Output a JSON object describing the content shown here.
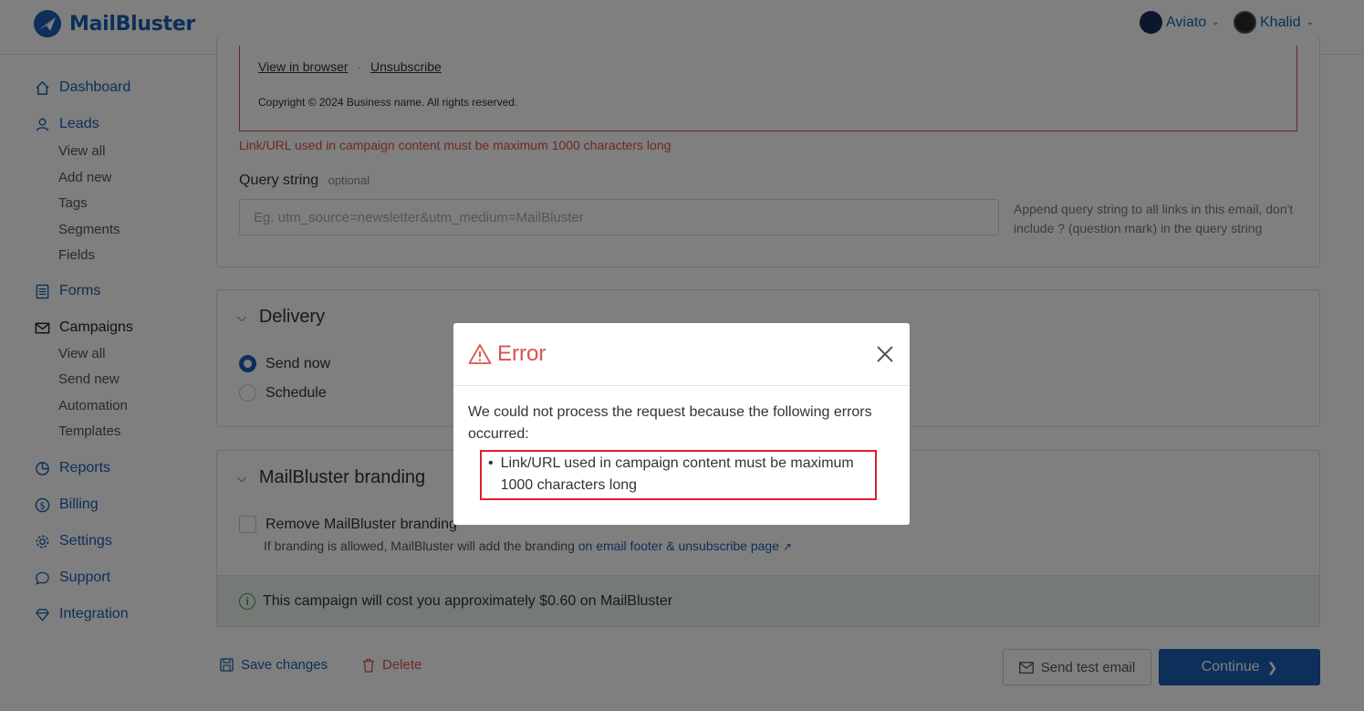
{
  "header": {
    "brand": "MailBluster",
    "org_menu": "Aviato",
    "user_menu": "Khalid"
  },
  "sidebar": {
    "items": [
      {
        "label": "Dashboard",
        "icon": "home-icon"
      },
      {
        "label": "Leads",
        "icon": "user-icon",
        "sub": [
          "View all",
          "Add new",
          "Tags",
          "Segments",
          "Fields"
        ]
      },
      {
        "label": "Forms",
        "icon": "form-icon"
      },
      {
        "label": "Campaigns",
        "icon": "envelope-icon",
        "active": true,
        "sub": [
          "View all",
          "Send new",
          "Automation",
          "Templates"
        ]
      },
      {
        "label": "Reports",
        "icon": "chart-pie-icon"
      },
      {
        "label": "Billing",
        "icon": "dollar-icon"
      },
      {
        "label": "Settings",
        "icon": "gear-icon"
      },
      {
        "label": "Support",
        "icon": "chat-icon"
      },
      {
        "label": "Integration",
        "icon": "diamond-icon"
      }
    ]
  },
  "content": {
    "footer_view_browser": "View in browser",
    "footer_separator": "·",
    "footer_unsubscribe": "Unsubscribe",
    "footer_copyright": "Copyright © 2024 Business name. All rights reserved.",
    "content_error": "Link/URL used in campaign content must be maximum 1000 characters long",
    "query_label": "Query string",
    "query_optional": "optional",
    "query_placeholder": "Eg. utm_source=newsletter&utm_medium=MailBluster",
    "query_help": "Append query string to all links in this email, don't include ? (question mark) in the query string",
    "delivery_title": "Delivery",
    "send_now": "Send now",
    "schedule": "Schedule",
    "branding_title": "MailBluster branding",
    "remove_branding": "Remove MailBluster branding",
    "branding_help": "If branding is allowed, MailBluster will add the branding",
    "branding_link": "on email footer & unsubscribe page",
    "cost_text": "This campaign will cost you approximately $0.60 on MailBluster",
    "save_changes": "Save changes",
    "delete": "Delete",
    "send_test": "Send test email",
    "continue": "Continue"
  },
  "modal": {
    "title": "Error",
    "message": "We could not process the request because the following errors occurred:",
    "errors": [
      "Link/URL used in campaign content must be maximum 1000 characters long"
    ]
  },
  "colors": {
    "brand": "#1a5fb4",
    "error": "#d9534f",
    "highlight_box": "#e0202a",
    "cost_bg": "#eaf5ec"
  }
}
